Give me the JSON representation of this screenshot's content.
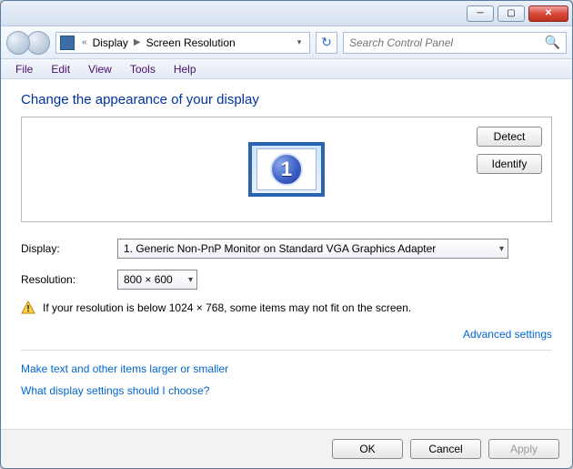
{
  "titlebar": {
    "minimize": "─",
    "maximize": "▢",
    "close": "✕"
  },
  "nav": {
    "path_segment_1": "Display",
    "path_segment_2": "Screen Resolution",
    "search_placeholder": "Search Control Panel"
  },
  "menu": {
    "file": "File",
    "edit": "Edit",
    "view": "View",
    "tools": "Tools",
    "help": "Help"
  },
  "page": {
    "heading": "Change the appearance of your display",
    "detect": "Detect",
    "identify": "Identify",
    "monitor_number": "1",
    "display_label": "Display:",
    "display_value": "1. Generic Non-PnP Monitor on Standard VGA Graphics Adapter",
    "resolution_label": "Resolution:",
    "resolution_value": "800 × 600",
    "warning_text": "If your resolution is below 1024 × 768, some items may not fit on the screen.",
    "advanced": "Advanced settings",
    "link_textsize": "Make text and other items larger or smaller",
    "link_help": "What display settings should I choose?"
  },
  "buttons": {
    "ok": "OK",
    "cancel": "Cancel",
    "apply": "Apply"
  }
}
